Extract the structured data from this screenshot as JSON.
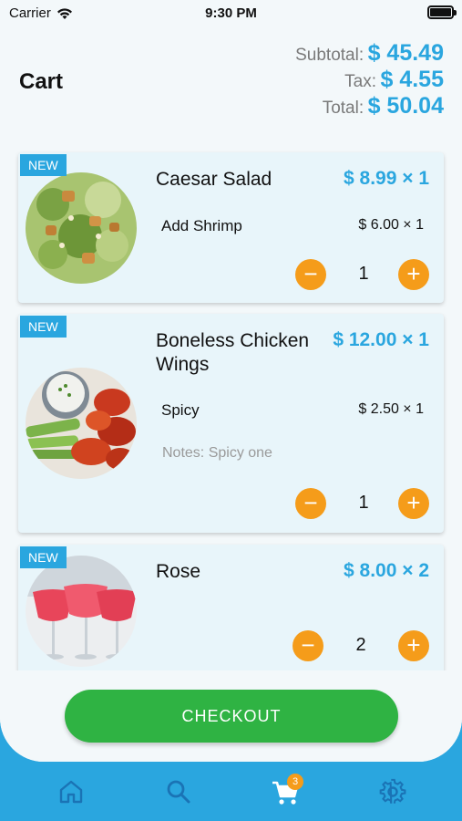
{
  "status_bar": {
    "carrier": "Carrier",
    "time": "9:30 PM"
  },
  "header": {
    "title": "Cart"
  },
  "totals": {
    "subtotal_label": "Subtotal:",
    "subtotal_value": "$ 45.49",
    "tax_label": "Tax:",
    "tax_value": "$ 4.55",
    "total_label": "Total:",
    "total_value": "$ 50.04"
  },
  "items": [
    {
      "badge": "NEW",
      "name": "Caesar Salad",
      "price": "$ 8.99 × 1",
      "option_name": "Add Shrimp",
      "option_price": "$ 6.00 × 1",
      "quantity": "1",
      "minus": "−",
      "plus": "+"
    },
    {
      "badge": "NEW",
      "name": "Boneless Chicken Wings",
      "price": "$ 12.00 × 1",
      "option_name": "Spicy",
      "option_price": "$ 2.50 × 1",
      "notes": "Notes: Spicy one",
      "quantity": "1",
      "minus": "−",
      "plus": "+"
    },
    {
      "badge": "NEW",
      "name": "Rose",
      "price": "$ 8.00 × 2",
      "quantity": "2",
      "minus": "−",
      "plus": "+"
    }
  ],
  "checkout": {
    "label": "CHECKOUT"
  },
  "tabs": [
    {
      "icon": "home-icon"
    },
    {
      "icon": "search-icon"
    },
    {
      "icon": "cart-icon",
      "badge": "3",
      "active": true
    },
    {
      "icon": "gear-icon"
    }
  ],
  "colors": {
    "accent": "#2aa6df",
    "button": "#f59c1a",
    "checkout": "#2fb343",
    "tab_inactive": "#1a73b5",
    "tab_active": "#ffffff"
  }
}
